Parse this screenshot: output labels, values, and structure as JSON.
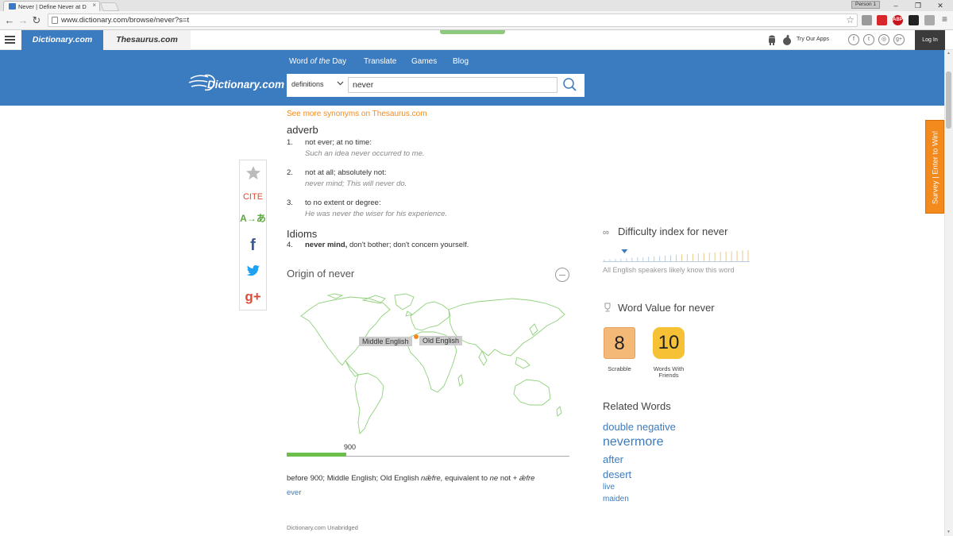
{
  "browser": {
    "tab_title": "Never | Define Never at D",
    "tab_close": "×",
    "profile": "Person 1",
    "url": "www.dictionary.com/browse/never?s=t",
    "win_min": "–",
    "win_max": "❐",
    "win_close": "✕"
  },
  "site_nav": {
    "tab_dictionary": "Dictionary.com",
    "tab_thesaurus": "Thesaurus.com",
    "try_apps": "Try Our Apps",
    "login": "Log In",
    "social": [
      "f",
      "t",
      "◎",
      "g+"
    ]
  },
  "header": {
    "logo_text": "Dictionary.com",
    "nav": {
      "word_of_day_a": "Word",
      "word_of_day_b": "of the",
      "word_of_day_c": "Day",
      "translate": "Translate",
      "games": "Games",
      "blog": "Blog"
    },
    "search": {
      "mode": "definitions",
      "query": "never"
    }
  },
  "survey": "Survey | Enter to Win!",
  "share": {
    "cite": "CITE",
    "translate": "A→あ",
    "facebook": "f",
    "google": "g+"
  },
  "entry": {
    "synonyms_link": "See more synonyms on Thesaurus.com",
    "part_of_speech": "adverb",
    "definitions": [
      {
        "num": "1.",
        "text": "not ever; at no time:",
        "example": "Such an idea never occurred to me."
      },
      {
        "num": "2.",
        "text": "not at all; absolutely not:",
        "example": "never mind; This will never do."
      },
      {
        "num": "3.",
        "text": "to no extent or degree:",
        "example": "He was never the wiser for his experience."
      }
    ],
    "idioms_heading": "Idioms",
    "idiom": {
      "num": "4.",
      "phrase": "never mind,",
      "meaning": "don't bother; don't concern yourself."
    }
  },
  "origin": {
    "title": "Origin of never",
    "map_labels": {
      "middle_english": "Middle English",
      "old_english": "Old English"
    },
    "timeline_year": "900",
    "timeline_fraction": 0.21,
    "etymology_a": "before 900; Middle English; Old English",
    "etymology_b": "nǣfre,",
    "etymology_c": "equivalent to",
    "etymology_d": "ne",
    "etymology_e": "not +",
    "etymology_f": "ǣfre",
    "etymology_link": "ever",
    "source": "Dictionary.com Unabridged"
  },
  "difficulty": {
    "title": "Difficulty index for never",
    "note": "All English speakers likely know this word",
    "level_fraction": 0.14
  },
  "word_value": {
    "title": "Word Value for never",
    "scrabble_score": "8",
    "scrabble_label": "Scrabble",
    "wwf_score": "10",
    "wwf_label_1": "Words With",
    "wwf_label_2": "Friends"
  },
  "related": {
    "title": "Related Words",
    "words": [
      "double negative",
      "nevermore",
      "after",
      "desert",
      "live",
      "maiden"
    ]
  }
}
